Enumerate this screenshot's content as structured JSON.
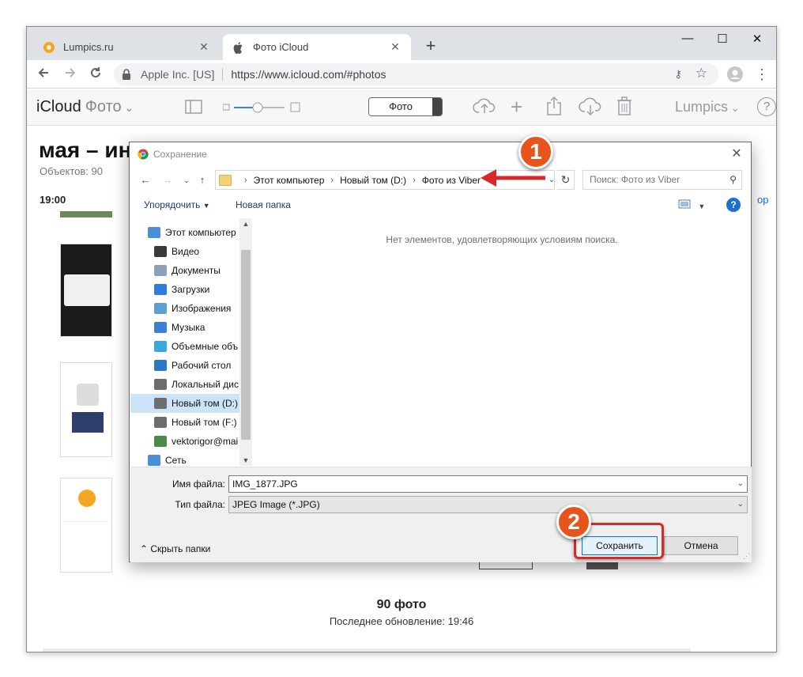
{
  "browser": {
    "tabs": [
      {
        "title": "Lumpics.ru"
      },
      {
        "title": "Фото iCloud"
      }
    ],
    "new_tab": "+",
    "window_controls": {
      "minimize": "—",
      "maximize": "☐",
      "close": "✕"
    },
    "tab_close": "✕",
    "site_identity": "Apple Inc. [US]",
    "url": "https://www.icloud.com/#photos"
  },
  "icloud": {
    "brand": "iCloud",
    "app": "Фото",
    "segment_label": "Фото",
    "user": "Lumpics",
    "help": "?",
    "album_title": "мая – ин",
    "object_count": "Объектов: 90",
    "time_header": "19:00",
    "right_link": "ор",
    "footer_count": "90 фото",
    "footer_updated": "Последнее обновление: 19:46"
  },
  "dialog": {
    "title": "Сохранение",
    "breadcrumb": [
      "Этот компьютер",
      "Новый том (D:)",
      "Фото из Viber"
    ],
    "search_placeholder": "Поиск: Фото из Viber",
    "organize": "Упорядочить",
    "new_folder": "Новая папка",
    "help": "?",
    "tree": [
      {
        "label": "Этот компьютер",
        "icon": "computer-icon",
        "color": "#4a90d9"
      },
      {
        "label": "Видео",
        "icon": "video-icon",
        "color": "#3a3a3a"
      },
      {
        "label": "Документы",
        "icon": "documents-icon",
        "color": "#8ca2b8"
      },
      {
        "label": "Загрузки",
        "icon": "downloads-icon",
        "color": "#2f7de1"
      },
      {
        "label": "Изображения",
        "icon": "images-icon",
        "color": "#5ba0d0"
      },
      {
        "label": "Музыка",
        "icon": "music-icon",
        "color": "#3d7fd6"
      },
      {
        "label": "Объемные объ",
        "icon": "3d-objects-icon",
        "color": "#39a9dc"
      },
      {
        "label": "Рабочий стол",
        "icon": "desktop-icon",
        "color": "#2a78c8"
      },
      {
        "label": "Локальный дис",
        "icon": "drive-icon",
        "color": "#6d6d6d"
      },
      {
        "label": "Новый том (D:)",
        "icon": "drive-icon",
        "color": "#6d6d6d"
      },
      {
        "label": "Новый том (F:)",
        "icon": "drive-icon",
        "color": "#6d6d6d"
      },
      {
        "label": "vektorigor@mai",
        "icon": "user-icon",
        "color": "#4a8a4a"
      },
      {
        "label": "Сеть",
        "icon": "network-icon",
        "color": "#4a90d9"
      }
    ],
    "selected_tree_item": "Новый том (D:)",
    "empty_message": "Нет элементов, удовлетворяющих условиям поиска.",
    "filename_label": "Имя файла:",
    "filename_value": "IMG_1877.JPG",
    "filetype_label": "Тип файла:",
    "filetype_value": "JPEG Image (*.JPG)",
    "hide_folders": "Скрыть папки",
    "save_button": "Сохранить",
    "cancel_button": "Отмена"
  },
  "annotations": {
    "step1": "1",
    "step2": "2",
    "colors": {
      "badge": "#e8541c",
      "highlight": "#d62a2a",
      "arrow": "#d62a2a"
    }
  }
}
